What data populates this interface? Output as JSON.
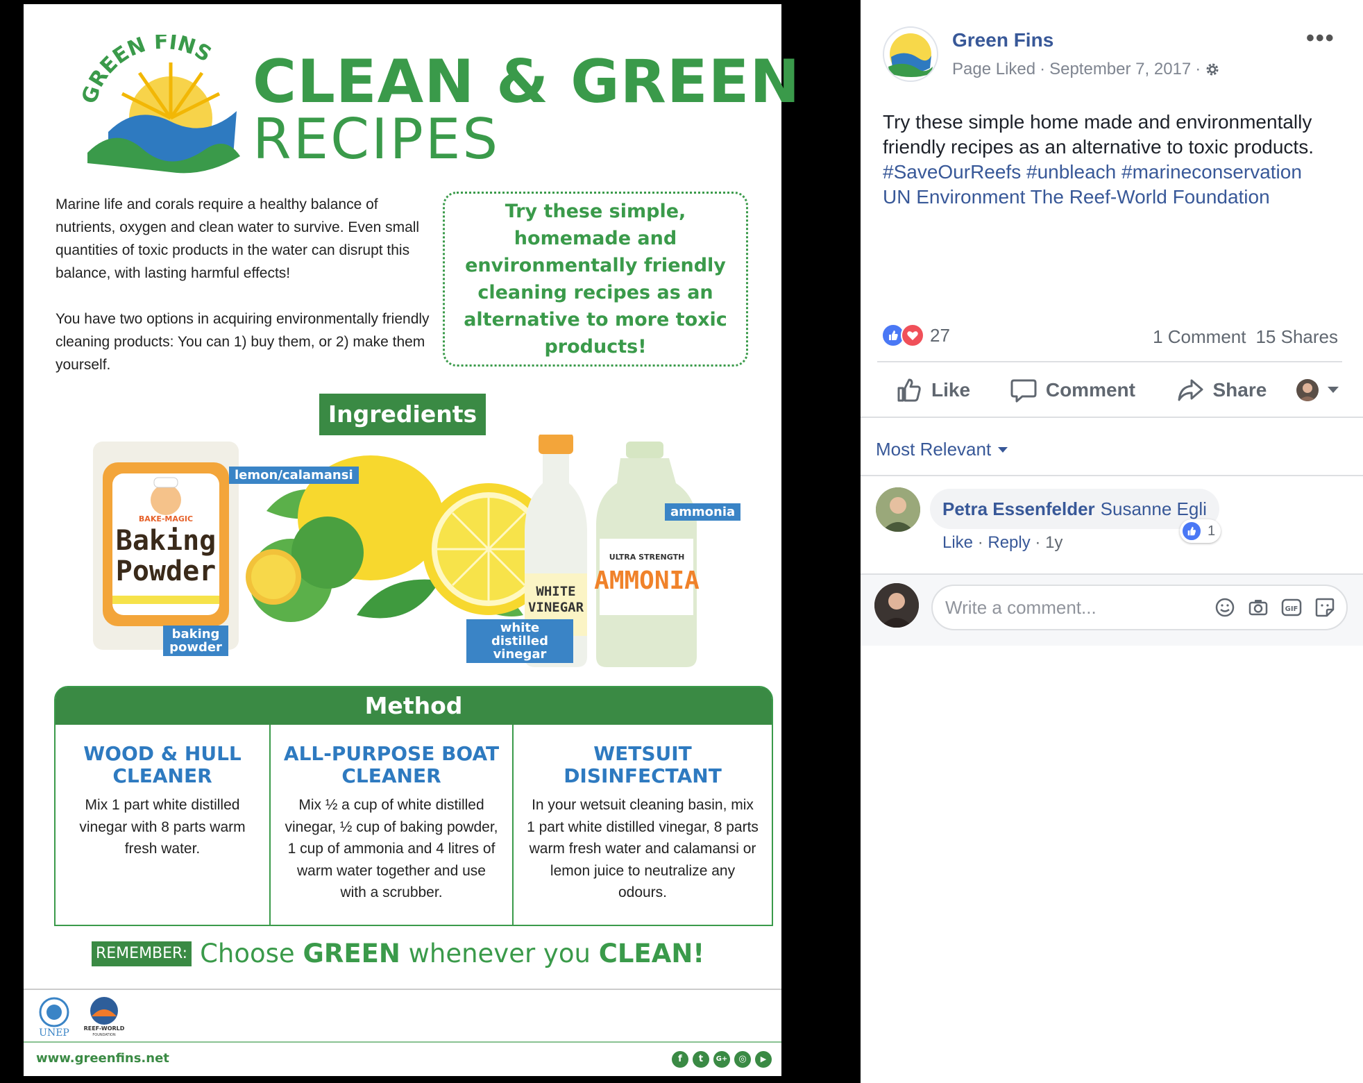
{
  "poster": {
    "logo_text": "GREEN FINS",
    "title_line1": "CLEAN & GREEN",
    "title_line2": "RECIPES",
    "intro_p1": "Marine life and corals require a healthy balance of nutrients, oxygen and clean water to survive. Even small quantities of toxic products in the water can disrupt this balance, with lasting harmful effects!",
    "intro_p2": "You have two options in acquiring environmentally friendly cleaning products: You can 1) buy them, or 2) make them yourself.",
    "callout": "Try these simple, homemade and environmentally friendly cleaning recipes as an alternative to more toxic products!",
    "ingredients_heading": "Ingredients",
    "ingredients": {
      "baking_powder_tag": "baking powder",
      "lemon_tag": "lemon/calamansi",
      "vinegar_tag": "white distilled vinegar",
      "ammonia_tag": "ammonia",
      "baking_box_brand": "BAKE-MAGIC",
      "baking_box_label": "Baking Powder",
      "vinegar_bottle_label": "WHITE VINEGAR",
      "ammonia_jug_small": "ULTRA STRENGTH",
      "ammonia_jug_label": "AMMONIA"
    },
    "method_heading": "Method",
    "methods": [
      {
        "title": "WOOD & HULL CLEANER",
        "text": "Mix 1 part white distilled vinegar with 8 parts warm fresh water."
      },
      {
        "title": "ALL-PURPOSE BOAT CLEANER",
        "text": "Mix ½ a cup of white distilled vinegar, ½ cup of baking powder, 1 cup of ammonia and 4 litres of warm water together and use with a scrubber."
      },
      {
        "title": "WETSUIT DISINFECTANT",
        "text": "In your wetsuit cleaning basin, mix 1 part white distilled vinegar, 8 parts warm fresh water and calamansi or lemon juice to neutralize any odours."
      }
    ],
    "remember_tag": "REMEMBER:",
    "remember_pre": "Choose ",
    "remember_green": "GREEN",
    "remember_mid": " whenever you ",
    "remember_clean": "CLEAN!",
    "footer_unep": "UNEP",
    "footer_reef": "REEF-WORLD",
    "footer_reef_sub": "FOUNDATION",
    "website": "www.greenfins.net",
    "socials": [
      "f",
      "t",
      "G+",
      "◎",
      "▶"
    ]
  },
  "post": {
    "page_name": "Green Fins",
    "page_status": "Page Liked",
    "date": "September 7, 2017",
    "text": "Try these simple home made and environmentally friendly recipes as an alternative to toxic products.",
    "hashtags": "#SaveOurReefs #unbleach #marineconservation",
    "mentions": "UN Environment The Reef-World Foundation",
    "reaction_count": "27",
    "comments_count": "1 Comment",
    "shares_count": "15 Shares",
    "actions": {
      "like": "Like",
      "comment": "Comment",
      "share": "Share"
    },
    "sort_label": "Most Relevant",
    "comment": {
      "author": "Petra Essenfelder",
      "tagged": "Susanne Egli",
      "like_link": "Like",
      "reply_link": "Reply",
      "age": "1y",
      "like_count": "1"
    },
    "write_placeholder": "Write a comment...",
    "colors": {
      "link": "#385898",
      "like_blue": "#4a78f5",
      "love_red": "#f05059",
      "green": "#3a9a4a"
    }
  }
}
